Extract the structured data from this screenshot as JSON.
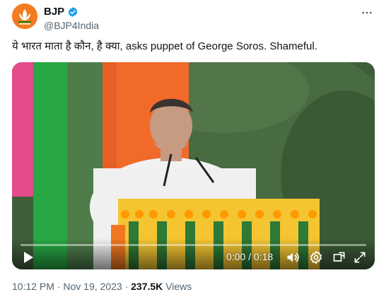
{
  "author": {
    "name": "BJP",
    "handle": "@BJP4India",
    "verified": true,
    "brand_color": "#f47b20",
    "verified_color": "#1d9bf0"
  },
  "tweet": {
    "text": "ये भारत माता है कौन, है क्या, asks puppet of George Soros. Shameful."
  },
  "video": {
    "current_time": "0:00",
    "separator": "/",
    "duration": "0:18",
    "progress": 0,
    "icons": {
      "play": "play-icon",
      "volume": "volume-icon",
      "settings": "settings-icon",
      "pip": "picture-in-picture-icon",
      "fullscreen": "fullscreen-icon"
    }
  },
  "meta": {
    "time": "10:12 PM",
    "dot1": "·",
    "date": "Nov 19, 2023",
    "dot2": "·",
    "views_count": "237.5K",
    "views_label": "Views"
  }
}
